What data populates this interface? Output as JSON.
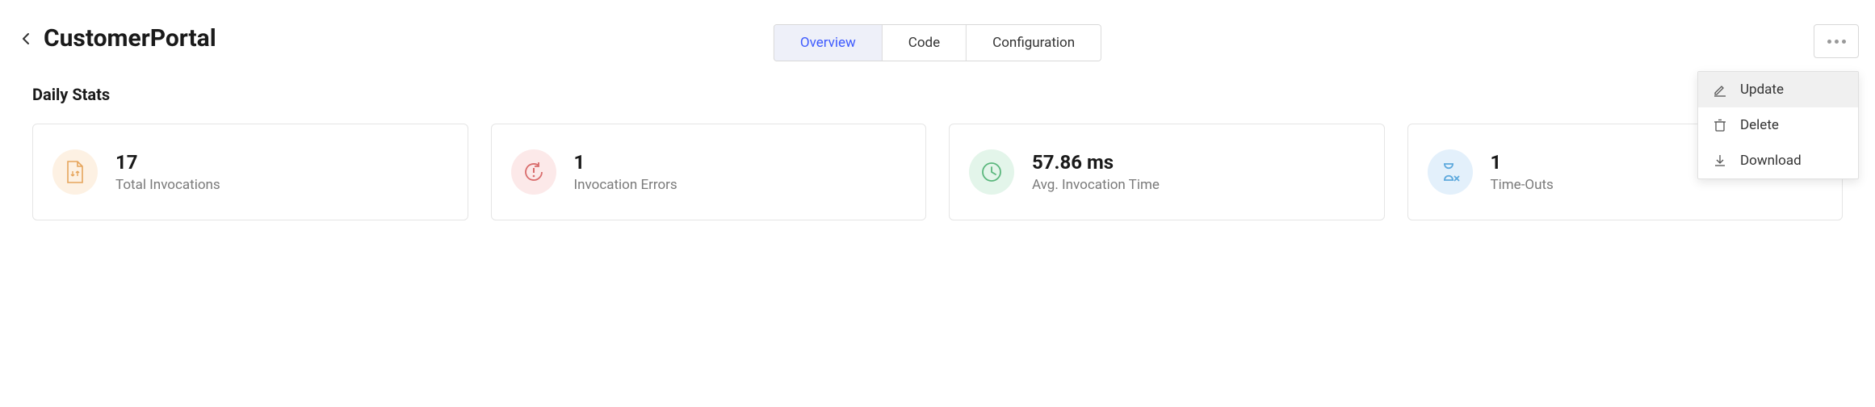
{
  "header": {
    "title": "CustomerPortal"
  },
  "tabs": [
    {
      "label": "Overview",
      "active": true
    },
    {
      "label": "Code",
      "active": false
    },
    {
      "label": "Configuration",
      "active": false
    }
  ],
  "dropdown": {
    "items": [
      {
        "label": "Update",
        "icon": "edit-icon",
        "highlighted": true
      },
      {
        "label": "Delete",
        "icon": "trash-icon",
        "highlighted": false
      },
      {
        "label": "Download",
        "icon": "download-icon",
        "highlighted": false
      }
    ]
  },
  "section": {
    "title": "Daily Stats"
  },
  "stats": [
    {
      "value": "17",
      "label": "Total Invocations",
      "icon": "file-icon",
      "color": "orange"
    },
    {
      "value": "1",
      "label": "Invocation Errors",
      "icon": "error-refresh-icon",
      "color": "red"
    },
    {
      "value": "57.86 ms",
      "label": "Avg. Invocation Time",
      "icon": "clock-icon",
      "color": "green"
    },
    {
      "value": "1",
      "label": "Time-Outs",
      "icon": "timeout-icon",
      "color": "blue"
    }
  ]
}
